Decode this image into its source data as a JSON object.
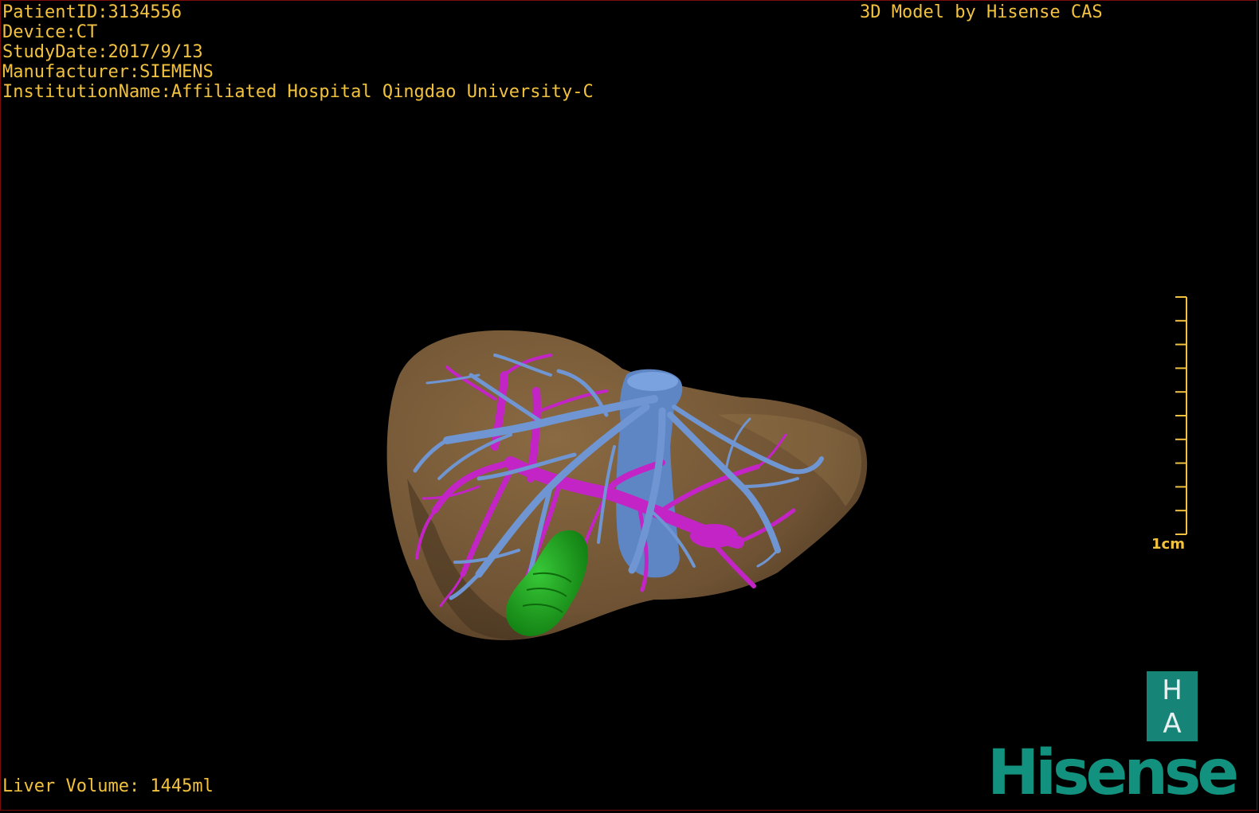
{
  "header": {
    "patient_id": "PatientID:3134556",
    "device": "Device:CT",
    "study_date": "StudyDate:2017/9/13",
    "manufacturer": "Manufacturer:SIEMENS",
    "institution": "InstitutionName:Affiliated Hospital Qingdao University-C",
    "credit": "3D Model by Hisense CAS"
  },
  "footer": {
    "liver_volume": "Liver Volume: 1445ml"
  },
  "scale_bar": {
    "label": "1cm",
    "tick_count": 11
  },
  "branding": {
    "badge_top": "H",
    "badge_bottom": "A",
    "wordmark": "Hisense"
  },
  "colors": {
    "text": "#f2c23e",
    "liver": "#7a5c38",
    "hepatic_vein": "#6f96d3",
    "portal_vein": "#c324c6",
    "gallbladder": "#1fa21f",
    "brand": "#13917f"
  }
}
